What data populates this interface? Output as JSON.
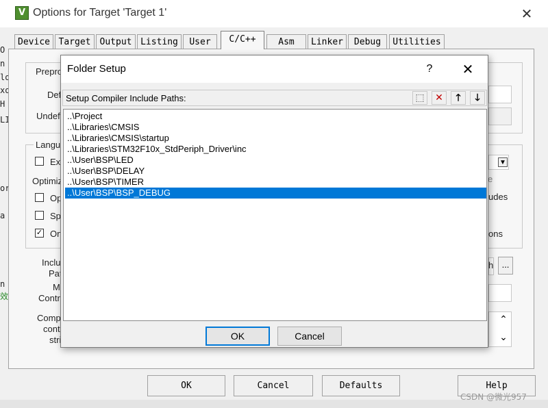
{
  "window": {
    "title": "Options for Target 'Target 1'",
    "close_glyph": "✕",
    "app_icon": "keil-uvision-icon",
    "app_icon_glyph": "V"
  },
  "left_fragments": [
    "O",
    "n",
    "lo",
    "xo",
    "H",
    "LI",
    "or",
    "a",
    "n",
    "效"
  ],
  "tabs": [
    "Device",
    "Target",
    "Output",
    "Listing",
    "User",
    "C/C++",
    "Asm",
    "Linker",
    "Debug",
    "Utilities"
  ],
  "active_tab": "C/C++",
  "background_panel": {
    "preproc_group": "Prepro",
    "define_label": "Def",
    "undefine_label": "Undef",
    "language_group": "Langu",
    "ex_option": "Ex",
    "optimize_label": "Optimiz",
    "op_option": "Op",
    "sp_option": "Sp",
    "on_option": "On",
    "include_label": "Inclu",
    "paths_label": "Pat",
    "misc_label": "M",
    "controls_label": "Contr",
    "compiler_label": "Comp",
    "control_label": "cont",
    "string_label": "stri",
    "right_e": "e",
    "right_udes": "udes",
    "right_ons": "ons",
    "right_h": "h",
    "browse_label": "...",
    "dropdown_arrow": "▼",
    "scroll_up": "⌃",
    "scroll_down": "⌄",
    "check_mark": "✓"
  },
  "bottom_buttons": {
    "ok": "OK",
    "cancel": "Cancel",
    "defaults": "Defaults",
    "help": "Help"
  },
  "watermark": "CSDN @微光957",
  "folder_setup": {
    "title": "Folder Setup",
    "help_glyph": "?",
    "close_glyph": "✕",
    "header_label": "Setup Compiler Include Paths:",
    "toolbar": {
      "new_glyph": "⬚",
      "delete_glyph": "✕",
      "up_glyph": "🡑",
      "down_glyph": "🡓"
    },
    "paths": [
      "..\\Project",
      "..\\Libraries\\CMSIS",
      "..\\Libraries\\CMSIS\\startup",
      "..\\Libraries\\STM32F10x_StdPeriph_Driver\\inc",
      "..\\User\\BSP\\LED",
      "..\\User\\BSP\\DELAY",
      "..\\User\\BSP\\TIMER",
      "..\\User\\BSP\\BSP_DEBUG"
    ],
    "selected_index": 7,
    "ok_label": "OK",
    "cancel_label": "Cancel"
  }
}
